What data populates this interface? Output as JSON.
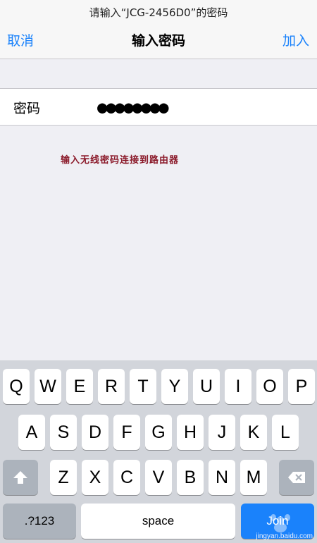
{
  "header": {
    "prompt": "请输入“JCG-2456D0”的密码",
    "cancel_label": "取消",
    "title": "输入密码",
    "join_label": "加入"
  },
  "form": {
    "password_label": "密码",
    "password_value": "●●●●●●●●"
  },
  "annotation": "输入无线密码连接到路由器",
  "keyboard": {
    "row1": [
      "Q",
      "W",
      "E",
      "R",
      "T",
      "Y",
      "U",
      "I",
      "O",
      "P"
    ],
    "row2": [
      "A",
      "S",
      "D",
      "F",
      "G",
      "H",
      "J",
      "K",
      "L"
    ],
    "row3": [
      "Z",
      "X",
      "C",
      "V",
      "B",
      "N",
      "M"
    ],
    "numbers_label": ".?123",
    "space_label": "space",
    "join_label": "Join",
    "shift_icon": "shift-icon",
    "backspace_icon": "backspace-icon"
  },
  "watermark": {
    "text": "jingyan.baidu.com"
  },
  "colors": {
    "accent": "#1a82fb",
    "annotation": "#8b1a2a",
    "background": "#efeff4",
    "keyboard": "#d2d5db"
  }
}
